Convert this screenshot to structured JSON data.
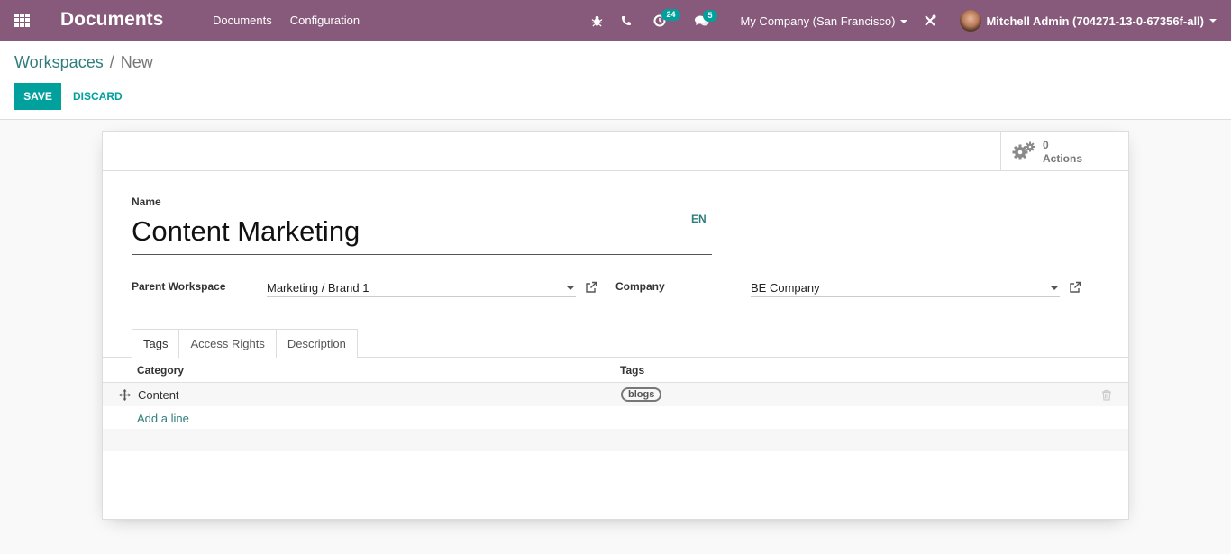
{
  "navbar": {
    "app_title": "Documents",
    "menu": [
      "Documents",
      "Configuration"
    ],
    "activity_count": "24",
    "message_count": "5",
    "company": "My Company (San Francisco)",
    "user": "Mitchell Admin (704271-13-0-67356f-all)"
  },
  "breadcrumb": {
    "parent": "Workspaces",
    "separator": "/",
    "current": "New"
  },
  "buttons": {
    "save": "SAVE",
    "discard": "DISCARD"
  },
  "stat_button": {
    "count": "0",
    "label": "Actions"
  },
  "form": {
    "name_label": "Name",
    "name_value": "Content Marketing",
    "lang": "EN",
    "parent_label": "Parent Workspace",
    "parent_value": "Marketing / Brand 1",
    "company_label": "Company",
    "company_value": "BE Company"
  },
  "tabs": [
    "Tags",
    "Access Rights",
    "Description"
  ],
  "table": {
    "columns": [
      "Category",
      "Tags"
    ],
    "rows": [
      {
        "category": "Content",
        "tags": [
          "blogs"
        ]
      }
    ],
    "add_line": "Add a line"
  },
  "colors": {
    "navbar": "#875a7b",
    "accent": "#00a09d"
  }
}
